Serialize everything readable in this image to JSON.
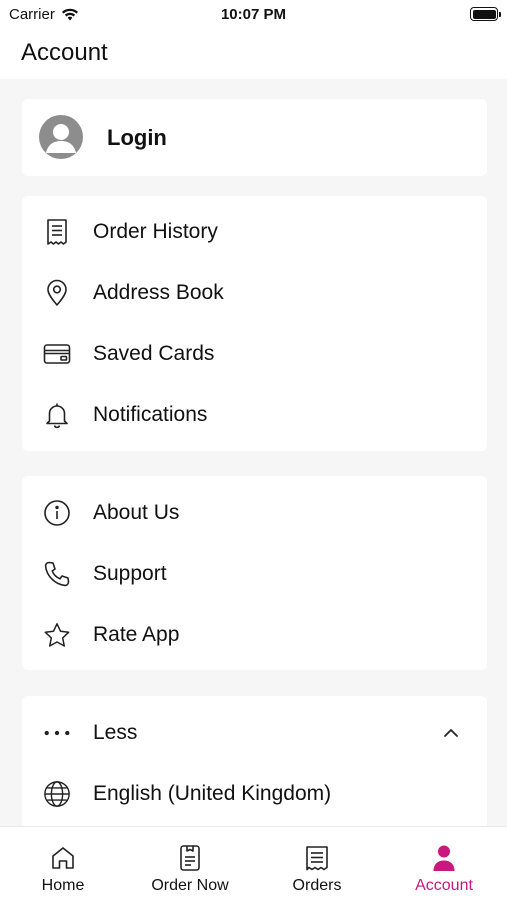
{
  "status_bar": {
    "carrier": "Carrier",
    "time": "10:07 PM"
  },
  "header": {
    "title": "Account"
  },
  "login": {
    "label": "Login"
  },
  "menu_group_1": [
    {
      "label": "Order History",
      "icon": "receipt-icon"
    },
    {
      "label": "Address Book",
      "icon": "location-pin-icon"
    },
    {
      "label": "Saved Cards",
      "icon": "credit-card-icon"
    },
    {
      "label": "Notifications",
      "icon": "bell-icon"
    }
  ],
  "menu_group_2": [
    {
      "label": "About Us",
      "icon": "info-icon"
    },
    {
      "label": "Support",
      "icon": "phone-icon"
    },
    {
      "label": "Rate App",
      "icon": "star-icon"
    }
  ],
  "menu_group_3": [
    {
      "label": "Less",
      "icon": "more-dots-icon"
    },
    {
      "label": "English (United Kingdom)",
      "icon": "globe-icon"
    }
  ],
  "tabbar": {
    "items": [
      {
        "label": "Home",
        "icon": "home-icon"
      },
      {
        "label": "Order Now",
        "icon": "order-now-icon"
      },
      {
        "label": "Orders",
        "icon": "orders-icon"
      },
      {
        "label": "Account",
        "icon": "account-icon"
      }
    ],
    "active_index": 3,
    "active_color": "#c8197f"
  }
}
